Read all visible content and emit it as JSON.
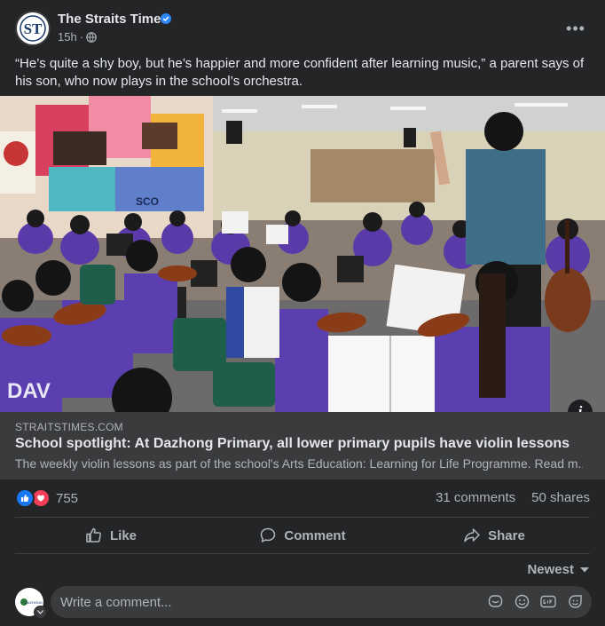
{
  "post": {
    "page_name": "The Straits Times",
    "time": "15h",
    "caption": "“He’s quite a shy boy, but he’s happier and more confident after learning music,” a parent says of his son, who now plays in the school’s orchestra.",
    "more_label": "•••"
  },
  "link": {
    "domain": "STRAITSTIMES.COM",
    "title": "School spotlight: At Dazhong Primary, all lower primary pupils have violin lessons",
    "description": "The weekly violin lessons as part of the school's Arts Education: Learning for Life Programme. Read m..."
  },
  "image": {
    "banner_text": "SCO",
    "shirt_text": "DAV"
  },
  "info_label": "i",
  "stats": {
    "reactions": "755",
    "comments": "31 comments",
    "shares": "50 shares"
  },
  "actions": {
    "like": "Like",
    "comment": "Comment",
    "share": "Share"
  },
  "sort": {
    "label": "Newest"
  },
  "comment_box": {
    "placeholder": "Write a comment..."
  },
  "logo": {
    "st_text": "ST",
    "me_text": "DAZHONG"
  },
  "colors": {
    "background": "#242526",
    "link_box": "#3a3b3c",
    "like_blue": "#1877f2",
    "love_red": "#f33e58",
    "verified_blue": "#2d88ff"
  },
  "icons": [
    "verified-icon",
    "globe-icon",
    "more-icon",
    "info-icon",
    "like-reaction-icon",
    "love-reaction-icon",
    "like-icon",
    "comment-icon",
    "share-icon",
    "chevron-down-icon",
    "sticker-icon",
    "emoji-icon",
    "gif-icon",
    "avatar-sticker-icon"
  ]
}
